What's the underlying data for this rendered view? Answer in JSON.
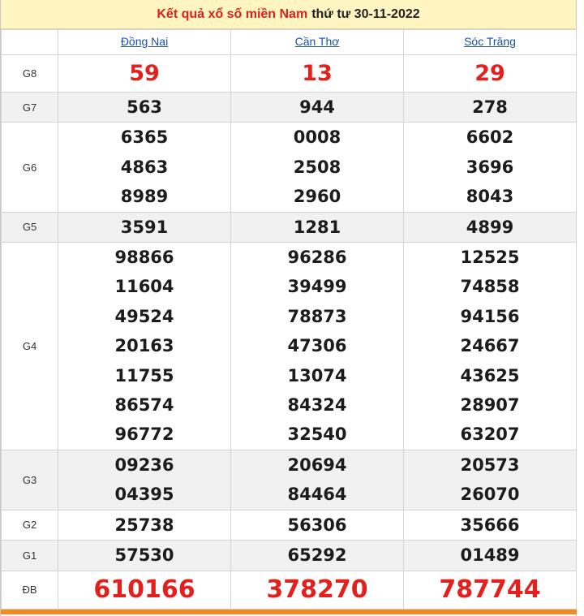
{
  "header": {
    "link_text": "Kết quả xổ số miền Nam",
    "rest_text": "thứ tư 30-11-2022"
  },
  "provinces": [
    "Đồng Nai",
    "Cần Thơ",
    "Sóc Trăng"
  ],
  "prizes": [
    {
      "label": "G8",
      "style": "red",
      "shade": false,
      "values": [
        [
          "59"
        ],
        [
          "13"
        ],
        [
          "29"
        ]
      ]
    },
    {
      "label": "G7",
      "style": "normal",
      "shade": true,
      "values": [
        [
          "563"
        ],
        [
          "944"
        ],
        [
          "278"
        ]
      ]
    },
    {
      "label": "G6",
      "style": "normal",
      "shade": false,
      "values": [
        [
          "6365",
          "4863",
          "8989"
        ],
        [
          "0008",
          "2508",
          "2960"
        ],
        [
          "6602",
          "3696",
          "8043"
        ]
      ]
    },
    {
      "label": "G5",
      "style": "normal",
      "shade": true,
      "values": [
        [
          "3591"
        ],
        [
          "1281"
        ],
        [
          "4899"
        ]
      ]
    },
    {
      "label": "G4",
      "style": "normal",
      "shade": false,
      "values": [
        [
          "98866",
          "11604",
          "49524",
          "20163",
          "11755",
          "86574",
          "96772"
        ],
        [
          "96286",
          "39499",
          "78873",
          "47306",
          "13074",
          "84324",
          "32540"
        ],
        [
          "12525",
          "74858",
          "94156",
          "24667",
          "43625",
          "28907",
          "63207"
        ]
      ]
    },
    {
      "label": "G3",
      "style": "normal",
      "shade": true,
      "values": [
        [
          "09236",
          "04395"
        ],
        [
          "20694",
          "84464"
        ],
        [
          "20573",
          "26070"
        ]
      ]
    },
    {
      "label": "G2",
      "style": "normal",
      "shade": false,
      "values": [
        [
          "25738"
        ],
        [
          "56306"
        ],
        [
          "35666"
        ]
      ]
    },
    {
      "label": "G1",
      "style": "normal",
      "shade": true,
      "values": [
        [
          "57530"
        ],
        [
          "65292"
        ],
        [
          "01489"
        ]
      ]
    },
    {
      "label": "ĐB",
      "style": "db",
      "shade": false,
      "values": [
        [
          "610166"
        ],
        [
          "378270"
        ],
        [
          "787744"
        ]
      ]
    }
  ],
  "colors": {
    "red": "#e3201c",
    "link_blue": "#1a4fb3",
    "header_bg": "#fff5c2",
    "bottom_bar": "#f28a1f"
  }
}
